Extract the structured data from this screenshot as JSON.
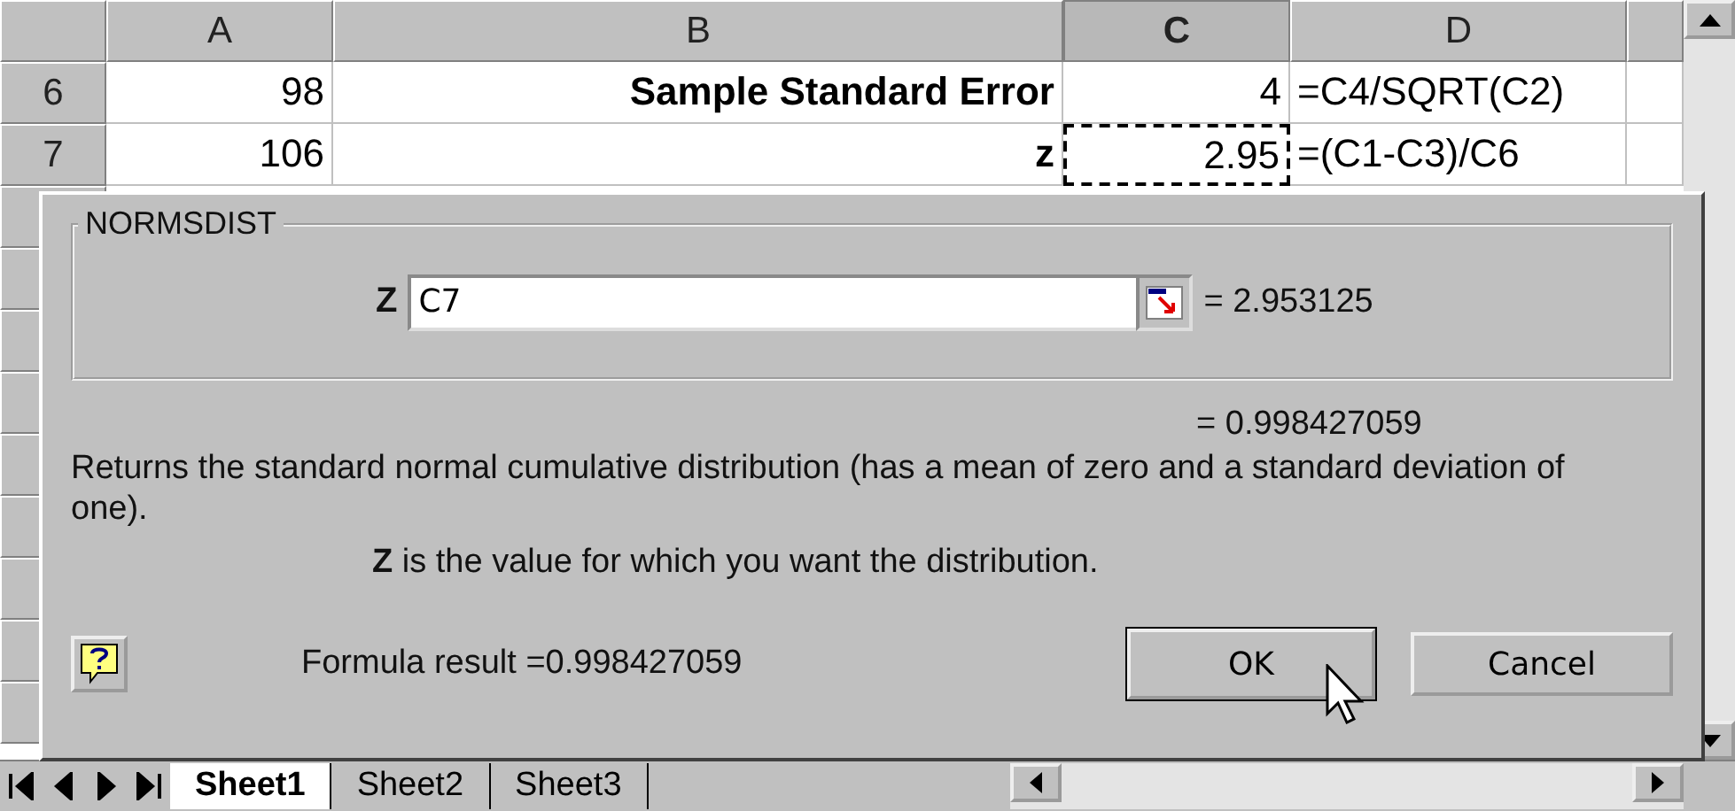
{
  "columns": [
    {
      "label": "A",
      "selected": false
    },
    {
      "label": "B",
      "selected": false
    },
    {
      "label": "C",
      "selected": true
    },
    {
      "label": "D",
      "selected": false
    }
  ],
  "rows": [
    {
      "number": "6",
      "cells": [
        {
          "text": "98",
          "kind": "value",
          "bold": false,
          "marquee": false
        },
        {
          "text": "Sample Standard Error",
          "kind": "value",
          "bold": true,
          "marquee": false
        },
        {
          "text": "4",
          "kind": "value",
          "bold": false,
          "marquee": false
        },
        {
          "text": "=C4/SQRT(C2)",
          "kind": "formula",
          "bold": false,
          "marquee": false
        }
      ]
    },
    {
      "number": "7",
      "cells": [
        {
          "text": "106",
          "kind": "value",
          "bold": false,
          "marquee": false
        },
        {
          "text": "z",
          "kind": "value",
          "bold": true,
          "marquee": false
        },
        {
          "text": "2.95",
          "kind": "value",
          "bold": false,
          "marquee": true
        },
        {
          "text": "=(C1-C3)/C6",
          "kind": "formula",
          "bold": false,
          "marquee": false
        }
      ]
    }
  ],
  "dialog": {
    "group_title": "NORMSDIST",
    "argument": {
      "label": "Z",
      "value": "C7",
      "result": "= 2.953125"
    },
    "function_result": "= 0.998427059",
    "description": "Returns the standard normal cumulative distribution (has a mean of zero and a standard deviation of one).",
    "argument_help": "**Z** is the value for which you want the distribution.",
    "formula_result": "Formula result =0.998427059",
    "buttons": [
      {
        "label": "OK",
        "default": true
      },
      {
        "label": "Cancel",
        "default": false
      }
    ]
  },
  "sheet_tabs": [
    {
      "label": "Sheet1",
      "selected": true
    },
    {
      "label": "Sheet2",
      "selected": false
    },
    {
      "label": "Sheet3",
      "selected": false
    }
  ]
}
